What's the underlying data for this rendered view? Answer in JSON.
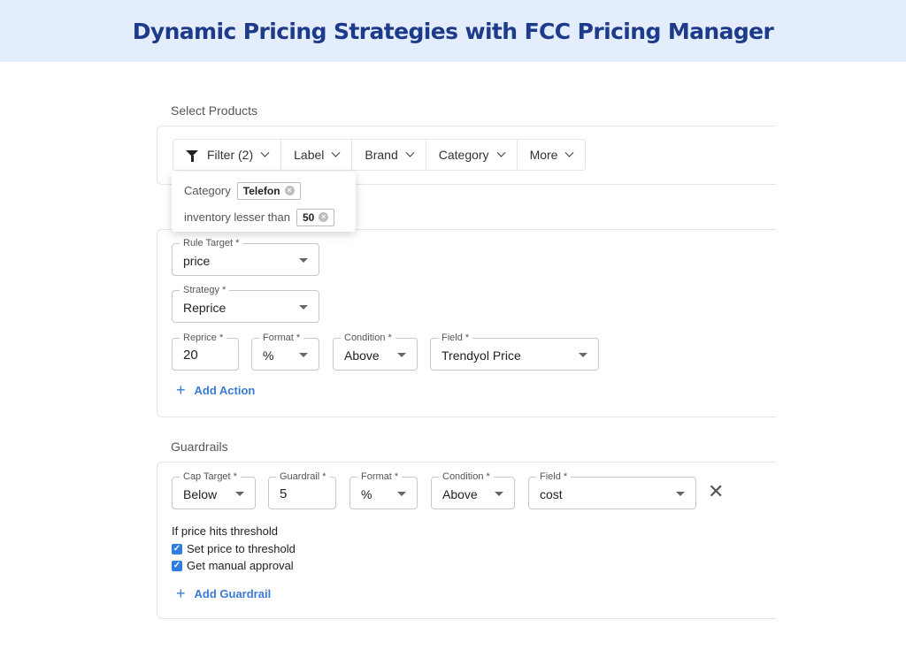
{
  "banner": {
    "title": "Dynamic Pricing Strategies with FCC Pricing Manager"
  },
  "select_products": {
    "label": "Select Products",
    "filters": [
      {
        "label": "Filter (2)",
        "icon": "funnel-icon"
      },
      {
        "label": "Label"
      },
      {
        "label": "Brand"
      },
      {
        "label": "Category"
      },
      {
        "label": "More"
      }
    ],
    "popover": {
      "rows": [
        {
          "label": "Category",
          "chip": "Telefon"
        },
        {
          "label": "inventory lesser than",
          "chip": "50"
        }
      ]
    }
  },
  "rule": {
    "rule_target": {
      "label": "Rule Target *",
      "value": "price"
    },
    "strategy": {
      "label": "Strategy *",
      "value": "Reprice"
    },
    "reprice": {
      "label": "Reprice *",
      "value": "20"
    },
    "format": {
      "label": "Format *",
      "value": "%"
    },
    "condition": {
      "label": "Condition *",
      "value": "Above"
    },
    "field": {
      "label": "Field *",
      "value": "Trendyol Price"
    },
    "add_action": "Add Action"
  },
  "guardrails": {
    "label": "Guardrails",
    "cap_target": {
      "label": "Cap Target *",
      "value": "Below"
    },
    "guardrail": {
      "label": "Guardrail *",
      "value": "5"
    },
    "format": {
      "label": "Format *",
      "value": "%"
    },
    "condition": {
      "label": "Condition *",
      "value": "Above"
    },
    "field": {
      "label": "Field *",
      "value": "cost"
    },
    "threshold_text": "If price hits threshold",
    "options": [
      {
        "label": "Set price to threshold",
        "checked": true
      },
      {
        "label": "Get manual approval",
        "checked": true
      }
    ],
    "add_guardrail": "Add Guardrail"
  },
  "colors": {
    "banner_bg": "#e4edfb",
    "title": "#1e3a8a",
    "accent": "#3b7bd4",
    "checkbox": "#2f7de1"
  }
}
